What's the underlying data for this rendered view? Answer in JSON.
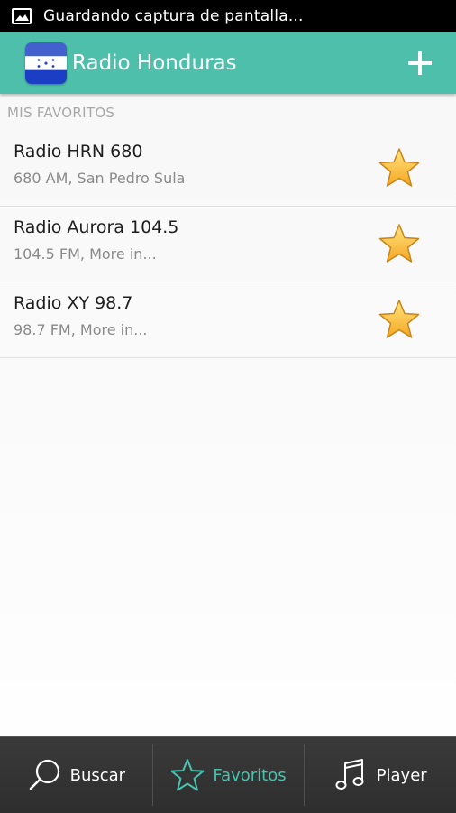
{
  "status_bar": {
    "notification_icon": "image-icon",
    "text": "Guardando captura de pantalla..."
  },
  "action_bar": {
    "title": "Radio Honduras",
    "add_icon": "plus-icon",
    "color": "#4dbfaa"
  },
  "favorites": {
    "section_title": "MIS FAVORITOS",
    "items": [
      {
        "name": "Radio HRN 680",
        "detail": "680 AM, San Pedro Sula"
      },
      {
        "name": "Radio Aurora 104.5",
        "detail": "104.5 FM, More in..."
      },
      {
        "name": "Radio XY 98.7",
        "detail": "98.7 FM, More in..."
      }
    ]
  },
  "bottom_nav": {
    "tabs": [
      {
        "label": "Buscar",
        "icon": "search-icon",
        "active": false
      },
      {
        "label": "Favoritos",
        "icon": "star-icon",
        "active": true
      },
      {
        "label": "Player",
        "icon": "music-note-icon",
        "active": false
      }
    ],
    "active_color": "#49c3ad"
  }
}
